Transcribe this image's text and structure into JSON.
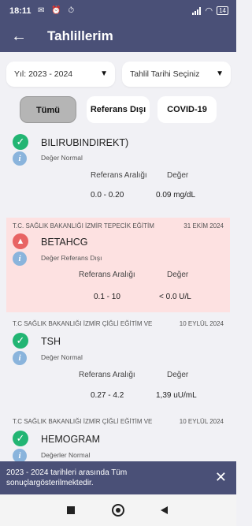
{
  "status_bar": {
    "time": "18:11",
    "left_icons": "✉ ⏰ ⏱",
    "battery": "14"
  },
  "app_bar": {
    "back_icon": "←",
    "title": "Tahlillerim"
  },
  "filters": {
    "year": "Yıl: 2023 - 2024",
    "date_placeholder": "Tahlil Tarihi Seçiniz",
    "caret": "▼"
  },
  "tabs": [
    {
      "label": "Tümü",
      "selected": true
    },
    {
      "label": "Referans Dışı",
      "selected": false
    },
    {
      "label": "COVID-19",
      "selected": false
    }
  ],
  "results": [
    {
      "hospital": "",
      "date": "",
      "name": "BILIRUBINDIREKT)",
      "status": "Değer Normal",
      "ref_header": "Referans Aralığı",
      "value_header": "Değer",
      "ref_range": "0.0 - 0.20",
      "value": "0.09 mg/dL",
      "icon": "check-icon",
      "alert": false
    },
    {
      "hospital": "T.C. SAĞLIK BAKANLIĞI İZMİR TEPECİK EĞİTİM",
      "date": "31 EKİM 2024",
      "name": "BETAHCG",
      "status": "Değer Referans Dışı",
      "ref_header": "Referans Aralığı",
      "value_header": "Değer",
      "ref_range": "0.1 - 10",
      "value": "< 0.0 U/L",
      "icon": "warning-icon",
      "alert": true
    },
    {
      "hospital": "T.C SAĞLIK BAKANLIĞI İZMİR ÇİĞLİ EĞİTİM VE",
      "date": "10 EYLÜL 2024",
      "name": "TSH",
      "status": "Değer Normal",
      "ref_header": "Referans Aralığı",
      "value_header": "Değer",
      "ref_range": "0.27 - 4.2",
      "value": "1,39 uU/mL",
      "icon": "check-icon",
      "alert": false
    },
    {
      "hospital": "T.C SAĞLIK BAKANLIĞI İZMİR ÇİĞLİ EĞİTİM VE",
      "date": "10 EYLÜL 2024",
      "name": "HEMOGRAM",
      "status": "Değerler Normal",
      "icon": "check-icon",
      "alert": false
    }
  ],
  "snackbar": {
    "message": "2023 - 2024 tarihleri arasında Tüm sonuçlargösterilmektedir.",
    "close": "✕"
  },
  "colors": {
    "primary": "#4a5077",
    "ok": "#22b573",
    "warning": "#e86464",
    "alert_bg": "#fde1e1",
    "info": "#8ab4dc"
  }
}
